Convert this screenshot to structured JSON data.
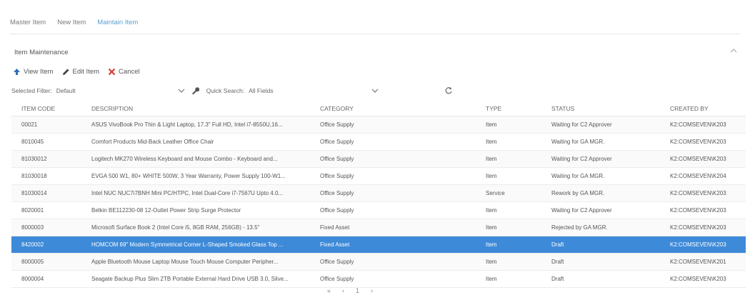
{
  "tabs": [
    {
      "label": "Master Item",
      "active": false
    },
    {
      "label": "New Item",
      "active": false
    },
    {
      "label": "Maintain Item",
      "active": true
    }
  ],
  "section": {
    "title": "Item Maintenance"
  },
  "toolbar": {
    "view_label": "View Item",
    "edit_label": "Edit Item",
    "cancel_label": "Cancel"
  },
  "filter": {
    "label": "Selected Filter:",
    "value": "Default",
    "quick_search_label": "Quick Search:",
    "quick_search_value": "All Fields"
  },
  "columns": [
    "ITEM CODE",
    "DESCRIPTION",
    "CATEGORY",
    "TYPE",
    "STATUS",
    "CREATED BY"
  ],
  "rows": [
    {
      "code": "00021",
      "description": "ASUS VivoBook Pro Thin & Light Laptop, 17.3\" Full HD, Intel i7-8550U,16...",
      "category": "Office Supply",
      "type": "Item",
      "status": "Waiting for C2 Approver",
      "created_by": "K2:COMSEVEN\\K203"
    },
    {
      "code": "8010045",
      "description": "Comfort Products Mid-Back Leather Office Chair",
      "category": "Office Supply",
      "type": "Item",
      "status": "Waiting for GA MGR.",
      "created_by": "K2:COMSEVEN\\K203"
    },
    {
      "code": "81030012",
      "description": "Logitech MK270 Wireless Keyboard and Mouse Combo - Keyboard and...",
      "category": "Office Supply",
      "type": "Item",
      "status": "Waiting for C2 Approver",
      "created_by": "K2:COMSEVEN\\K203"
    },
    {
      "code": "81030018",
      "description": "EVGA 500 W1, 80+ WHITE 500W, 3 Year Warranty, Power Supply 100-W1...",
      "category": "Office Supply",
      "type": "Item",
      "status": "Waiting for GA MGR.",
      "created_by": "K2:COMSEVEN\\K204"
    },
    {
      "code": "81030014",
      "description": "Intel NUC NUC7i7BNH Mini PC/HTPC, Intel Dual-Core i7-7567U Upto 4.0...",
      "category": "Office Supply",
      "type": "Service",
      "status": "Rework by GA MGR.",
      "created_by": "K2:COMSEVEN\\K203"
    },
    {
      "code": "8020001",
      "description": "Belkin BE112230-08 12-Outlet Power Strip Surge Protector",
      "category": "Office Supply",
      "type": "Item",
      "status": "Waiting for C2 Approver",
      "created_by": "K2:COMSEVEN\\K203"
    },
    {
      "code": "8000003",
      "description": "Microsoft Surface Book 2 (Intel Core i5, 8GB RAM, 256GB) - 13.5\"",
      "category": "Fixed Asset",
      "type": "Item",
      "status": "Rejected by GA MGR.",
      "created_by": "K2:COMSEVEN\\K203"
    },
    {
      "code": "8420002",
      "description": "HOMCOM 69\" Modern Symmetrical Corner L-Shaped Smoked Glass Top ...",
      "category": "Fixed Asset",
      "type": "Item",
      "status": "Draft",
      "created_by": "K2:COMSEVEN\\K203",
      "selected": true
    },
    {
      "code": "8000005",
      "description": "Apple Bluetooth Mouse Laptop Mouse Touch Mouse Computer Peripher...",
      "category": "Office Supply",
      "type": "Item",
      "status": "Draft",
      "created_by": "K2:COMSEVEN\\K201"
    },
    {
      "code": "8000004",
      "description": "Seagate Backup Plus Slim 2TB Portable External Hard Drive USB 3.0, Silve...",
      "category": "Office Supply",
      "type": "Item",
      "status": "Draft",
      "created_by": "K2:COMSEVEN\\K203"
    }
  ],
  "pager": {
    "first": "«",
    "prev": "‹",
    "page": "1",
    "next": "›"
  },
  "colors": {
    "accent": "#5aa0d0",
    "selected_row": "#3d8ad8",
    "cancel_red": "#d9352a"
  },
  "icons": {
    "view": "arrow-up-icon",
    "edit": "pencil-icon",
    "cancel": "x-icon",
    "wrench": "wrench-icon",
    "refresh": "refresh-icon",
    "collapse": "chevron-up-icon"
  }
}
